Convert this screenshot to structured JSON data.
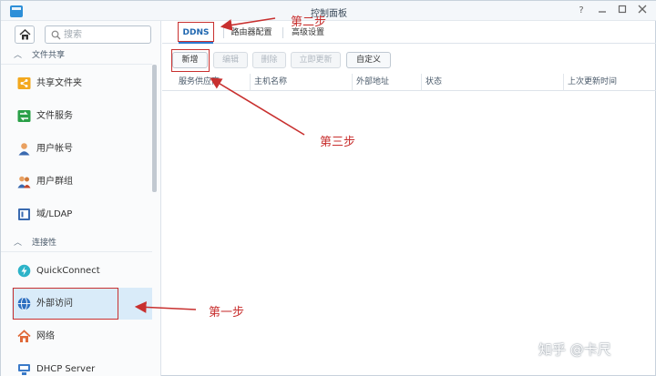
{
  "window": {
    "title": "控制面板"
  },
  "sidebar": {
    "search_placeholder": "搜索",
    "sections": [
      {
        "label": "文件共享"
      },
      {
        "label": "连接性"
      }
    ],
    "items": [
      {
        "label": "共享文件夹",
        "icon": "shared-folder-icon",
        "color": "#f0a020"
      },
      {
        "label": "文件服务",
        "icon": "file-services-icon",
        "color": "#2aa048"
      },
      {
        "label": "用户帐号",
        "icon": "user-icon",
        "color": "#e08a3a"
      },
      {
        "label": "用户群组",
        "icon": "user-group-icon",
        "color": "#e08a3a"
      },
      {
        "label": "域/LDAP",
        "icon": "domain-ldap-icon",
        "color": "#3a6ab0"
      },
      {
        "label": "QuickConnect",
        "icon": "quickconnect-icon",
        "color": "#2cb3c8"
      },
      {
        "label": "外部访问",
        "icon": "globe-icon",
        "color": "#2d6fc0",
        "active": true
      },
      {
        "label": "网络",
        "icon": "network-house-icon",
        "color": "#e06a3a"
      },
      {
        "label": "DHCP Server",
        "icon": "dhcp-icon",
        "color": "#3a7ac8"
      }
    ]
  },
  "tabs": [
    {
      "label": "DDNS",
      "active": true
    },
    {
      "label": "路由器配置"
    },
    {
      "label": "高级设置"
    }
  ],
  "toolbar": {
    "buttons": [
      {
        "label": "新增",
        "disabled": false
      },
      {
        "label": "编辑",
        "disabled": true
      },
      {
        "label": "删除",
        "disabled": true
      },
      {
        "label": "立即更新",
        "disabled": true
      },
      {
        "label": "自定义",
        "disabled": false
      }
    ]
  },
  "table": {
    "columns": [
      "服务供应商",
      "主机名称",
      "外部地址",
      "状态",
      "上次更新时间"
    ]
  },
  "annotations": {
    "step1": "第一步",
    "step2": "第二步",
    "step3": "第三步",
    "color": "#c8302f"
  },
  "watermark": "知乎 @卡尺"
}
